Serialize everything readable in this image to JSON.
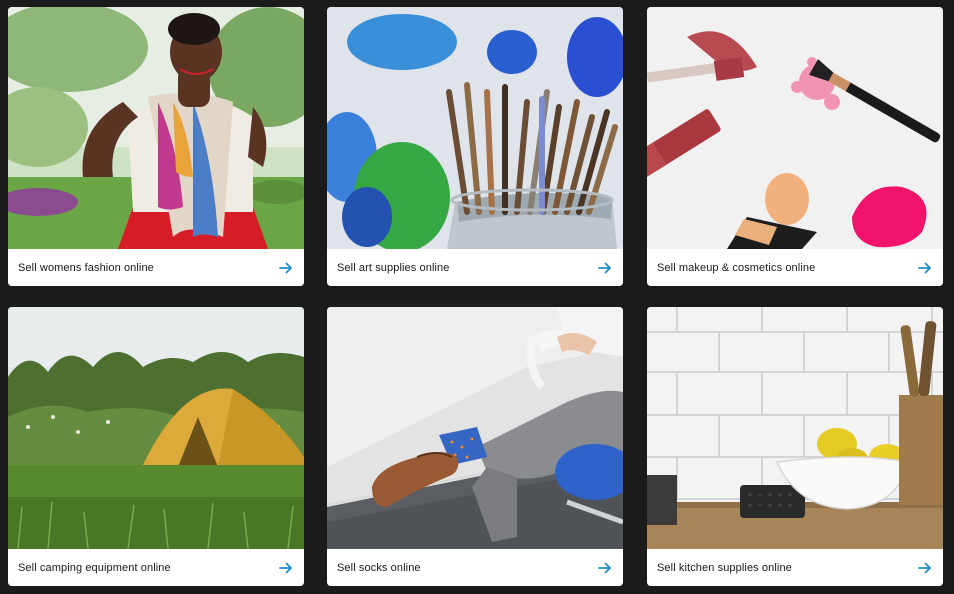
{
  "cards": [
    {
      "label": "Sell womens fashion online",
      "image": "woman in colorful scarf and red skirt in park",
      "icon": "arrow-right-icon"
    },
    {
      "label": "Sell art supplies online",
      "image": "paint brushes in a jar with blue and green paint",
      "icon": "arrow-right-icon"
    },
    {
      "label": "Sell makeup & cosmetics online",
      "image": "lipstick, brush, foundation and beauty sponge on marble",
      "icon": "arrow-right-icon"
    },
    {
      "label": "Sell camping equipment online",
      "image": "yellow tent in a grassy field",
      "icon": "arrow-right-icon"
    },
    {
      "label": "Sell socks online",
      "image": "person in grey trousers and blue socks sitting on chair",
      "icon": "arrow-right-icon"
    },
    {
      "label": "Sell kitchen supplies online",
      "image": "lemons in bowl on kitchen counter with white tiles",
      "icon": "arrow-right-icon"
    }
  ],
  "colors": {
    "accent": "#1f8fc6",
    "background": "#1b1b1b",
    "card": "#ffffff"
  }
}
